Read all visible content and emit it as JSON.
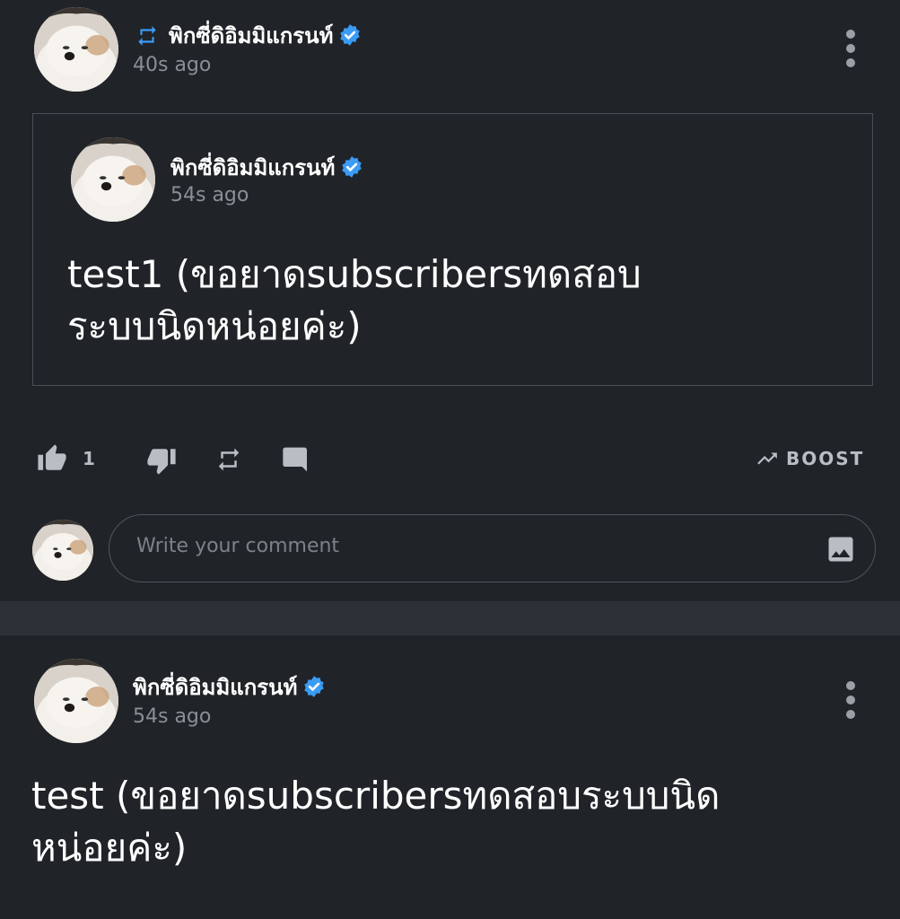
{
  "post1": {
    "author": "พิกซี่ดิอิมมิแกรนท์",
    "time": "40s ago",
    "reposted": true
  },
  "quoted": {
    "author": "พิกซี่ดิอิมมิแกรนท์",
    "time": "54s ago",
    "text_line1": "test1 (ขอยาดsubscribersทดสอบ",
    "text_line2": "ระบบนิดหน่อยค่ะ)"
  },
  "actions": {
    "like_count": "1",
    "boost_label": "BOOST"
  },
  "comment": {
    "placeholder": "Write your comment"
  },
  "post2": {
    "author": "พิกซี่ดิอิมมิแกรนท์",
    "time": "54s ago",
    "text_line1": "test (ขอยาดsubscribersทดสอบระบบนิด",
    "text_line2": "หน่อยค่ะ)"
  },
  "colors": {
    "background": "#202428",
    "verified": "#3b9cf6",
    "muted": "#8a8f96"
  },
  "icons": [
    "repost-icon",
    "verified-badge-icon",
    "more-options-icon",
    "thumbs-up-icon",
    "thumbs-down-icon",
    "remind-icon",
    "comment-icon",
    "trending-up-icon",
    "image-icon"
  ]
}
